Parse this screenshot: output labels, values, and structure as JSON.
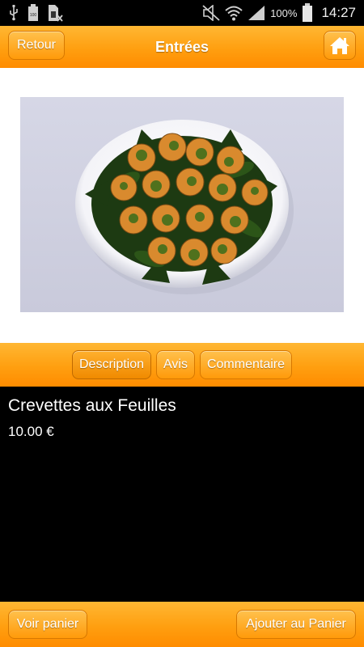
{
  "status_bar": {
    "icons": [
      "usb-icon",
      "battery-100-icon",
      "sim-blocked-icon",
      "mute-icon",
      "wifi-icon",
      "signal-icon",
      "battery-icon"
    ],
    "battery_percent": "100%",
    "time": "14:27"
  },
  "header": {
    "back_label": "Retour",
    "title": "Entrées",
    "home_icon": "home-icon"
  },
  "image": {
    "subject": "plate-of-shrimp-with-leaves"
  },
  "tabs": [
    {
      "label": "Description",
      "active": true
    },
    {
      "label": "Avis",
      "active": false
    },
    {
      "label": "Commentaire",
      "active": false
    }
  ],
  "product": {
    "name": "Crevettes aux Feuilles",
    "price": "10.00 €"
  },
  "footer": {
    "view_cart_label": "Voir panier",
    "add_to_cart_label": "Ajouter au Panier"
  },
  "colors": {
    "accent": "#ff9f10",
    "background": "#000000",
    "text": "#ffffff"
  }
}
